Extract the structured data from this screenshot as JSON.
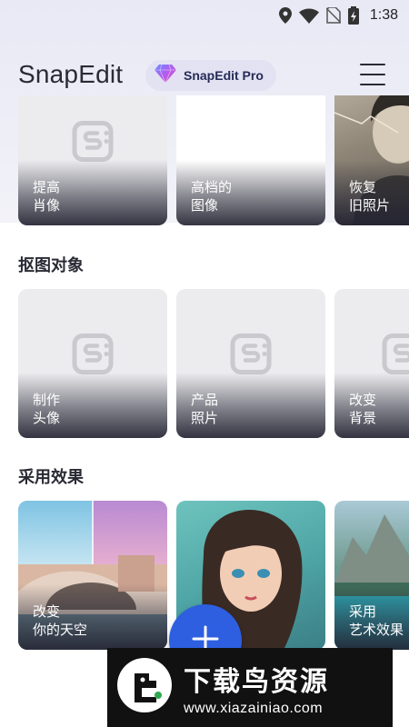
{
  "status_bar": {
    "time": "1:38",
    "icons": [
      "location-icon",
      "wifi-icon",
      "no-sim-icon",
      "battery-charging-icon"
    ]
  },
  "header": {
    "title": "SnapEdit",
    "pro_label": "SnapEdit Pro",
    "pro_icon": "diamond-icon",
    "menu_icon": "hamburger-menu-icon"
  },
  "row1": {
    "cards": [
      {
        "line1": "提高",
        "line2": "肖像",
        "placeholder_icon": "snapedit-logo-icon"
      },
      {
        "line1": "高档的",
        "line2": "图像"
      },
      {
        "line1": "恢复",
        "line2": "旧照片"
      }
    ]
  },
  "section_cutout": {
    "title": "抠图对象",
    "cards": [
      {
        "line1": "制作",
        "line2": "头像",
        "placeholder_icon": "snapedit-logo-icon"
      },
      {
        "line1": "产品",
        "line2": "照片",
        "placeholder_icon": "snapedit-logo-icon"
      },
      {
        "line1": "改变",
        "line2": "背景",
        "placeholder_icon": "snapedit-logo-icon"
      }
    ]
  },
  "section_effects": {
    "title": "采用效果",
    "cards": [
      {
        "line1": "改变",
        "line2": "你的天空"
      },
      {
        "line1": "",
        "line2": ""
      },
      {
        "line1": "采用",
        "line2": "艺术效果"
      }
    ]
  },
  "fab": {
    "icon": "plus-icon"
  },
  "watermark": {
    "title": "下载鸟资源",
    "url": "www.xiazainiao.com"
  },
  "colors": {
    "accent": "#2d5fe0",
    "pro_pill_bg": "#e2e2f3",
    "header_bg": "#eeeef7"
  }
}
